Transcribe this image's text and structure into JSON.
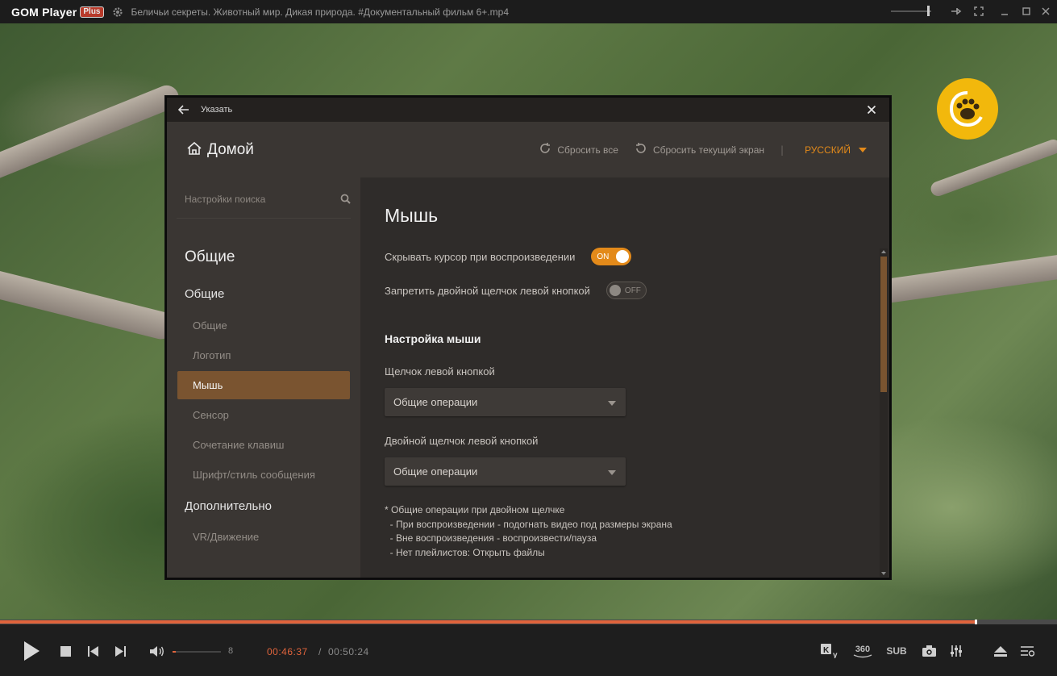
{
  "titlebar": {
    "logo": "GOM Player",
    "logo_plus": "Plus",
    "file_title": "Беличьи секреты. Животный мир. Дикая природа. #Документальный фильм 6+.mp4"
  },
  "dialog": {
    "title": "Указать",
    "home_label": "Домой",
    "reset_all": "Сбросить все",
    "reset_screen": "Сбросить текущий экран",
    "separator": "|",
    "language": "РУССКИЙ",
    "search_placeholder": "Настройки поиска",
    "sidebar": {
      "heading": "Общие",
      "group1": "Общие",
      "items": [
        {
          "label": "Общие"
        },
        {
          "label": "Логотип"
        },
        {
          "label": "Мышь"
        },
        {
          "label": "Сенсор"
        },
        {
          "label": "Сочетание клавиш"
        },
        {
          "label": "Шрифт/стиль сообщения"
        }
      ],
      "group2": "Дополнительно",
      "items2": [
        {
          "label": "VR/Движение"
        }
      ]
    },
    "main": {
      "title": "Мышь",
      "opt_hide_cursor": "Скрывать курсор при воспроизведении",
      "opt_hide_cursor_state": "ON",
      "opt_disable_dblclick": "Запретить двойной щелчок левой кнопкой",
      "opt_disable_dblclick_state": "OFF",
      "section": "Настройка мыши",
      "left_click_label": "Щелчок левой кнопкой",
      "left_click_value": "Общие операции",
      "dbl_click_label": "Двойной щелчок левой кнопкой",
      "dbl_click_value": "Общие операции",
      "note": [
        "* Общие операции при двойном щелчке",
        "  - При воспроизведении - подогнать видео под размеры экрана",
        "  - Вне воспроизведения - воспроизвести/пауза",
        "  - Нет плейлистов: Открыть файлы"
      ]
    }
  },
  "player": {
    "progress": 0.922,
    "volume_value": "8",
    "time_current": "00:46:37",
    "time_sep": "/",
    "time_total": "00:50:24",
    "btn_360": "360",
    "btn_sub": "SUB"
  },
  "colors": {
    "accent": "#e38a1a",
    "active_nav": "#7a5430",
    "progress": "#e0643c"
  }
}
